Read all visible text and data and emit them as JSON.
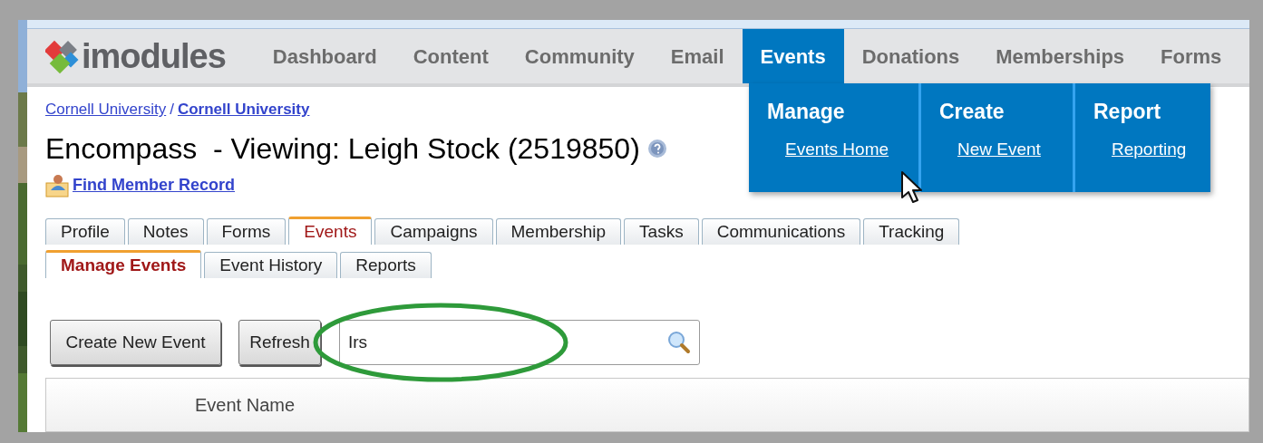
{
  "logo": {
    "text": "imodules"
  },
  "nav": [
    {
      "label": "Dashboard",
      "selected": false
    },
    {
      "label": "Content",
      "selected": false
    },
    {
      "label": "Community",
      "selected": false
    },
    {
      "label": "Email",
      "selected": false
    },
    {
      "label": "Events",
      "selected": true
    },
    {
      "label": "Donations",
      "selected": false
    },
    {
      "label": "Memberships",
      "selected": false
    },
    {
      "label": "Forms",
      "selected": false
    }
  ],
  "dropdown": [
    {
      "heading": "Manage",
      "link": "Events Home"
    },
    {
      "heading": "Create",
      "link": "New Event"
    },
    {
      "heading": "Report",
      "link": "Reporting"
    }
  ],
  "breadcrumb": [
    "Cornell University",
    "Cornell University"
  ],
  "breadcrumb_separator": "/",
  "title": "Encompass  - Viewing: Leigh Stock (2519850)",
  "find_member_link": "Find Member Record",
  "tabs": [
    {
      "label": "Profile",
      "selected": false
    },
    {
      "label": "Notes",
      "selected": false
    },
    {
      "label": "Forms",
      "selected": false
    },
    {
      "label": "Events",
      "selected": true
    },
    {
      "label": "Campaigns",
      "selected": false
    },
    {
      "label": "Membership",
      "selected": false
    },
    {
      "label": "Tasks",
      "selected": false
    },
    {
      "label": "Communications",
      "selected": false
    },
    {
      "label": "Tracking",
      "selected": false
    }
  ],
  "subtabs": [
    {
      "label": "Manage Events",
      "selected": true
    },
    {
      "label": "Event History",
      "selected": false
    },
    {
      "label": "Reports",
      "selected": false
    }
  ],
  "buttons": [
    "Create New Event",
    "Refresh"
  ],
  "search": {
    "value": "Irs"
  },
  "table": {
    "columns": [
      "Event Name"
    ]
  }
}
